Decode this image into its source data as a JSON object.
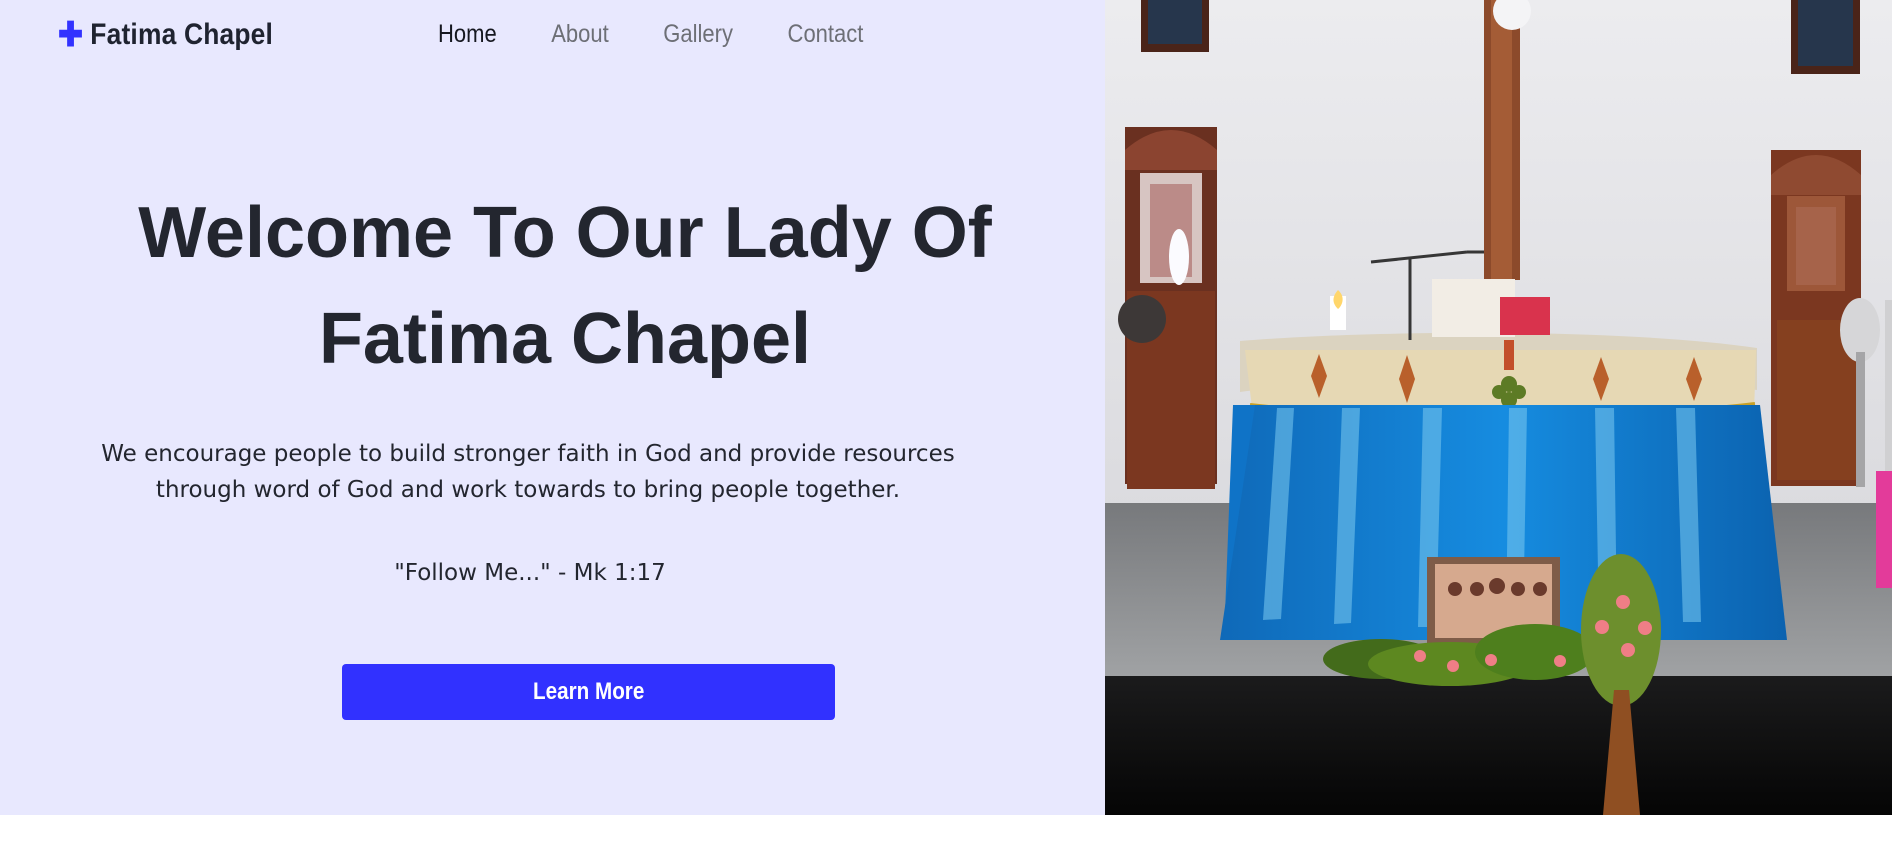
{
  "header": {
    "brand_icon": "plus-icon",
    "brand_name": "Fatima Chapel",
    "nav": [
      {
        "label": "Home",
        "active": true
      },
      {
        "label": "About",
        "active": false
      },
      {
        "label": "Gallery",
        "active": false
      },
      {
        "label": "Contact",
        "active": false
      }
    ]
  },
  "hero": {
    "title_line1": "Welcome To Our Lady Of",
    "title_line2": "Fatima Chapel",
    "description_line1": "We encourage people to build stronger faith in God and provide resources",
    "description_line2": "through word of God and work towards to bring people together.",
    "verse": "\"Follow Me...\" - Mk 1:17",
    "button_label": "Learn More"
  },
  "colors": {
    "accent": "#3232ff",
    "left_background": "#e8e8fe",
    "text_dark": "#23262f",
    "nav_muted": "#6d6f76"
  },
  "image": {
    "subject": "chapel altar photograph"
  }
}
